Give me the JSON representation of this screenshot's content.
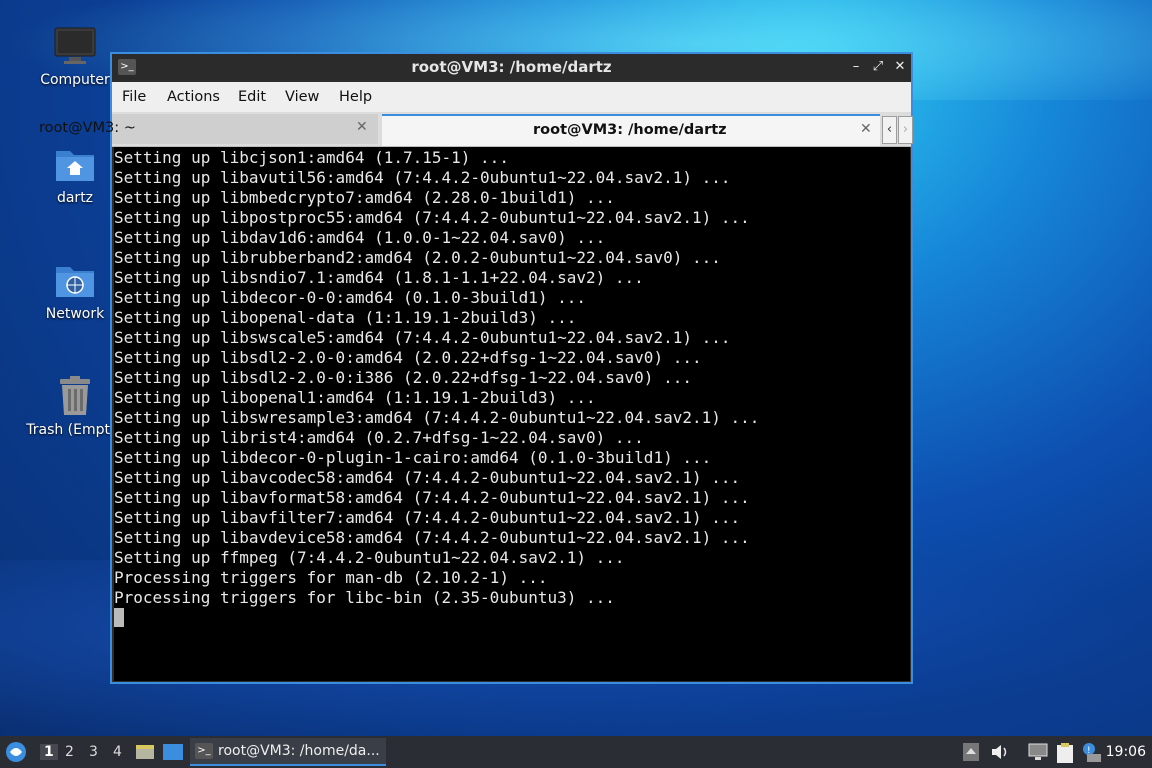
{
  "desktop": {
    "icons": [
      {
        "label": "Computer"
      },
      {
        "label": "dartz"
      },
      {
        "label": "Network"
      },
      {
        "label": "Trash (Empty)"
      }
    ]
  },
  "window": {
    "title": "root@VM3: /home/dartz",
    "menu": [
      "File",
      "Actions",
      "Edit",
      "View",
      "Help"
    ],
    "tabs": [
      {
        "label": "root@VM3: ~",
        "active": false
      },
      {
        "label": "root@VM3: /home/dartz",
        "active": true
      }
    ],
    "terminal_lines": [
      "Setting up libcjson1:amd64 (1.7.15-1) ...",
      "Setting up libavutil56:amd64 (7:4.4.2-0ubuntu1~22.04.sav2.1) ...",
      "Setting up libmbedcrypto7:amd64 (2.28.0-1build1) ...",
      "Setting up libpostproc55:amd64 (7:4.4.2-0ubuntu1~22.04.sav2.1) ...",
      "Setting up libdav1d6:amd64 (1.0.0-1~22.04.sav0) ...",
      "Setting up librubberband2:amd64 (2.0.2-0ubuntu1~22.04.sav0) ...",
      "Setting up libsndio7.1:amd64 (1.8.1-1.1+22.04.sav2) ...",
      "Setting up libdecor-0-0:amd64 (0.1.0-3build1) ...",
      "Setting up libopenal-data (1:1.19.1-2build3) ...",
      "Setting up libswscale5:amd64 (7:4.4.2-0ubuntu1~22.04.sav2.1) ...",
      "Setting up libsdl2-2.0-0:amd64 (2.0.22+dfsg-1~22.04.sav0) ...",
      "Setting up libsdl2-2.0-0:i386 (2.0.22+dfsg-1~22.04.sav0) ...",
      "Setting up libopenal1:amd64 (1:1.19.1-2build3) ...",
      "Setting up libswresample3:amd64 (7:4.4.2-0ubuntu1~22.04.sav2.1) ...",
      "Setting up librist4:amd64 (0.2.7+dfsg-1~22.04.sav0) ...",
      "Setting up libdecor-0-plugin-1-cairo:amd64 (0.1.0-3build1) ...",
      "Setting up libavcodec58:amd64 (7:4.4.2-0ubuntu1~22.04.sav2.1) ...",
      "Setting up libavformat58:amd64 (7:4.4.2-0ubuntu1~22.04.sav2.1) ...",
      "Setting up libavfilter7:amd64 (7:4.4.2-0ubuntu1~22.04.sav2.1) ...",
      "Setting up libavdevice58:amd64 (7:4.4.2-0ubuntu1~22.04.sav2.1) ...",
      "Setting up ffmpeg (7:4.4.2-0ubuntu1~22.04.sav2.1) ...",
      "Processing triggers for man-db (2.10.2-1) ...",
      "Processing triggers for libc-bin (2.35-0ubuntu3) ..."
    ]
  },
  "taskbar": {
    "workspaces": [
      "1",
      "2",
      "3",
      "4"
    ],
    "active_workspace": "1",
    "task_label": "root@VM3: /home/da...",
    "clock": "19:06"
  },
  "colors": {
    "accent": "#3b8de0",
    "terminal_bg": "#000000",
    "taskbar_bg": "#2a2d33"
  }
}
